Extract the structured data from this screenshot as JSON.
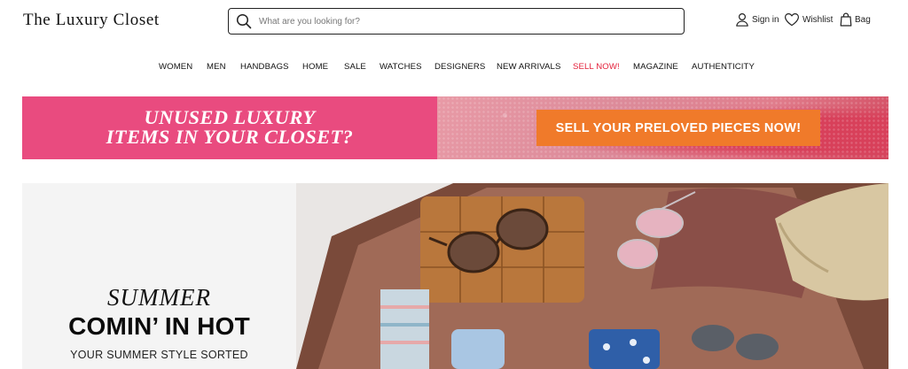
{
  "header": {
    "logo": "The Luxury Closet",
    "search_placeholder": "What are you looking for?",
    "signin_label": "Sign in",
    "wishlist_label": "Wishlist",
    "bag_label": "Bag"
  },
  "nav": {
    "items": [
      "WOMEN",
      "MEN",
      "HANDBAGS",
      "HOME",
      "SALE",
      "WATCHES",
      "DESIGNERS",
      "NEW ARRIVALS",
      "SELL NOW!",
      "MAGAZINE",
      "AUTHENTICITY"
    ]
  },
  "banner": {
    "headline_line1": "Unused luxury",
    "headline_line2": "items in your closet?",
    "cta_label": "SELL YOUR PRELOVED PIECES NOW!",
    "colors": {
      "left_bg": "#e94b7f",
      "cta_bg": "#f07a2a"
    }
  },
  "hero": {
    "kicker": "Summer",
    "title": "COMIN’ IN HOT",
    "subtitle": "YOUR SUMMER STYLE SORTED"
  },
  "icons": {
    "search": "search-icon",
    "user": "user-icon",
    "heart": "heart-icon",
    "bag": "bag-icon"
  },
  "colors": {
    "accent_sale": "#e4213b"
  }
}
